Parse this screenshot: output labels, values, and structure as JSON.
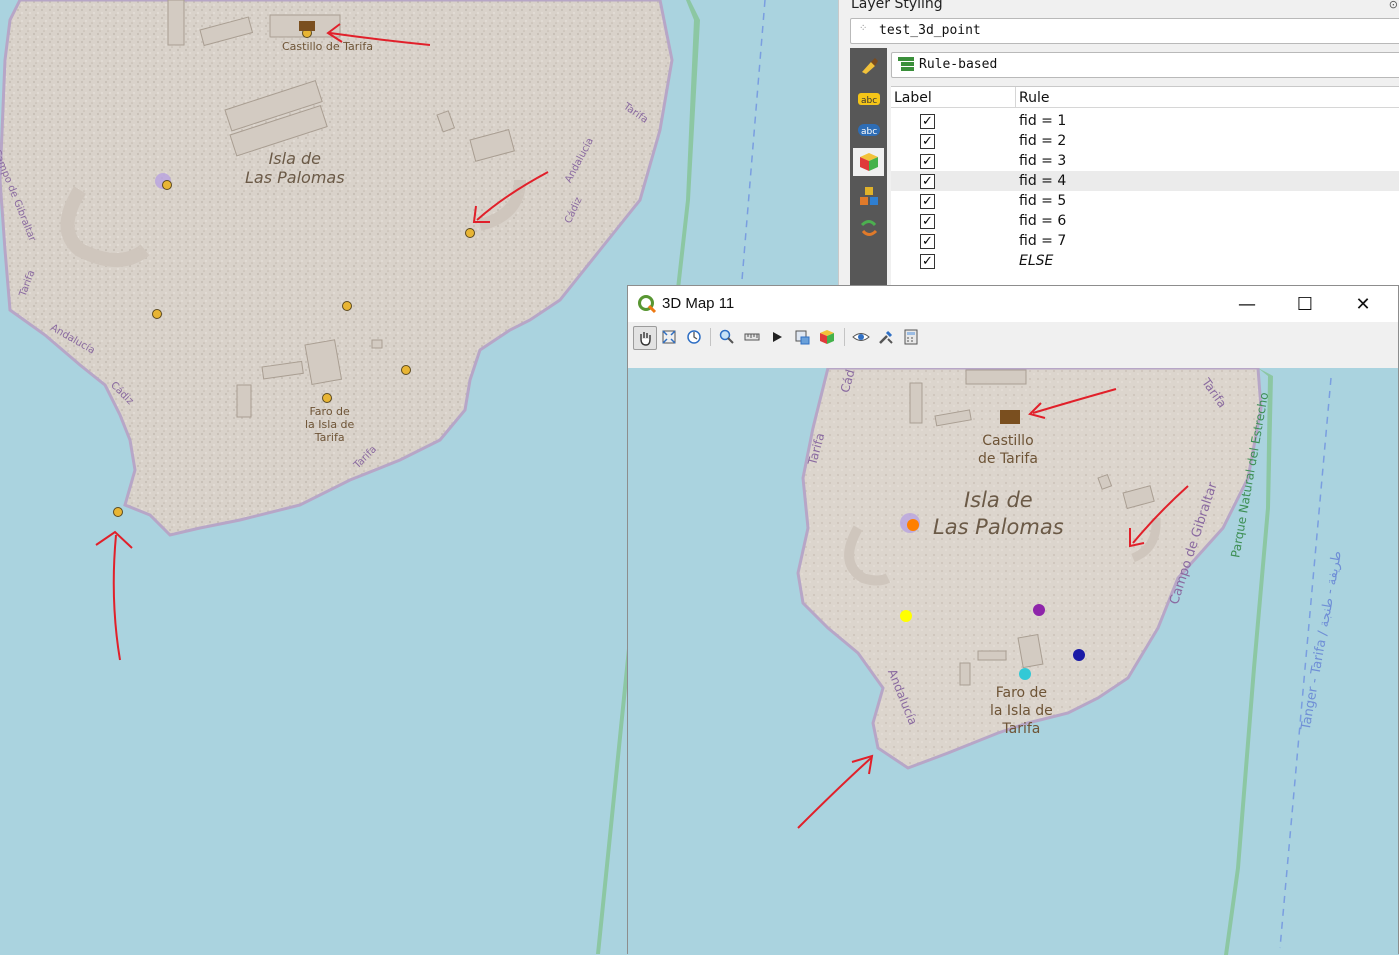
{
  "map2d": {
    "labels": {
      "island": "Isla de\nLas Palomas",
      "castle": "Castillo\nde Tarifa",
      "lighthouse": "Faro de\nla Isla de\nTarifa",
      "road_campo": "Campo de Gibraltar",
      "road_tarifa_1": "Tarifa",
      "road_tarifa_2": "Tarifa",
      "road_tarifa_3": "Tarifa",
      "road_andalucia_1": "Andalucía",
      "road_andalucia_2": "Andalucía",
      "road_cadiz_1": "Cádiz",
      "road_cadiz_2": "Cádiz"
    }
  },
  "layer_styling": {
    "title": "Layer Styling",
    "layer_name": "test_3d_point",
    "renderer": "Rule-based",
    "columns": [
      "Label",
      "Rule"
    ],
    "rules": [
      {
        "rule": "fid = 1",
        "checked": true
      },
      {
        "rule": "fid = 2",
        "checked": true
      },
      {
        "rule": "fid = 3",
        "checked": true
      },
      {
        "rule": "fid = 4",
        "checked": true,
        "selected": true
      },
      {
        "rule": "fid = 5",
        "checked": true
      },
      {
        "rule": "fid = 6",
        "checked": true
      },
      {
        "rule": "fid = 7",
        "checked": true
      },
      {
        "rule": "ELSE",
        "checked": true
      }
    ],
    "tabs": [
      "symbology",
      "labels",
      "masks",
      "3d-view",
      "diagrams",
      "history"
    ]
  },
  "map3d": {
    "title": "3D Map 11",
    "labels": {
      "island": "Isla de\nLas Palomas",
      "castle": "Castillo\nde Tarifa",
      "lighthouse": "Faro de\nla Isla de\nTarifa",
      "road_campo": "Campo de Gibraltar",
      "road_tarifa_1": "Tarifa",
      "road_tarifa_2": "Tarifa",
      "road_andalucia": "Andalucía",
      "road_cadiz": "Cád",
      "park": "Parque Natural del Estrecho",
      "ferry": "Tanger - Tarifa / طريفة - طنجة"
    },
    "point_colors": [
      "#ff7f00",
      "#ffff00",
      "#8e24aa",
      "#1a1aa6",
      "#33c9d6"
    ]
  }
}
